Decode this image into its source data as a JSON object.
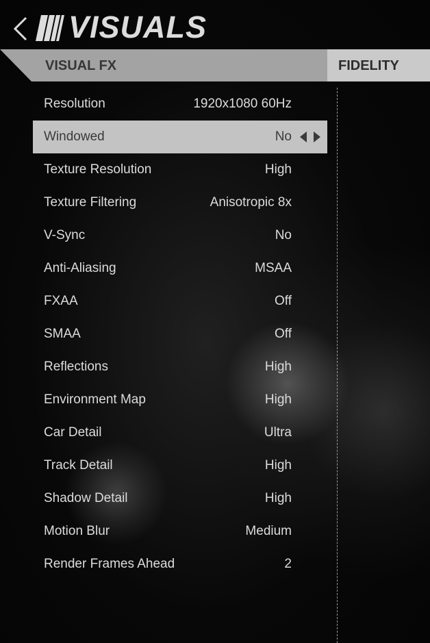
{
  "header": {
    "title": "VISUALS",
    "back_icon": "chevron-left-icon",
    "logo_icon": "stripes-logo-icon"
  },
  "tabs": [
    {
      "label": "VISUAL FX",
      "active": true
    },
    {
      "label": "FIDELITY",
      "active": false
    }
  ],
  "settings": [
    {
      "label": "Resolution",
      "value": "1920x1080 60Hz"
    },
    {
      "label": "Windowed",
      "value": "No",
      "selected": true
    },
    {
      "label": "Texture Resolution",
      "value": "High"
    },
    {
      "label": "Texture Filtering",
      "value": "Anisotropic 8x"
    },
    {
      "label": "V-Sync",
      "value": "No"
    },
    {
      "label": "Anti-Aliasing",
      "value": "MSAA"
    },
    {
      "label": "FXAA",
      "value": "Off"
    },
    {
      "label": "SMAA",
      "value": "Off"
    },
    {
      "label": "Reflections",
      "value": "High"
    },
    {
      "label": "Environment Map",
      "value": "High"
    },
    {
      "label": "Car Detail",
      "value": "Ultra"
    },
    {
      "label": "Track Detail",
      "value": "High"
    },
    {
      "label": "Shadow Detail",
      "value": "High"
    },
    {
      "label": "Motion Blur",
      "value": "Medium"
    },
    {
      "label": "Render Frames Ahead",
      "value": "2"
    }
  ],
  "colors": {
    "text": "#dcdcdc",
    "selected_row": "#c3c3c3",
    "tab_active": "#a3a3a3",
    "tab_inactive": "#cacaca"
  }
}
